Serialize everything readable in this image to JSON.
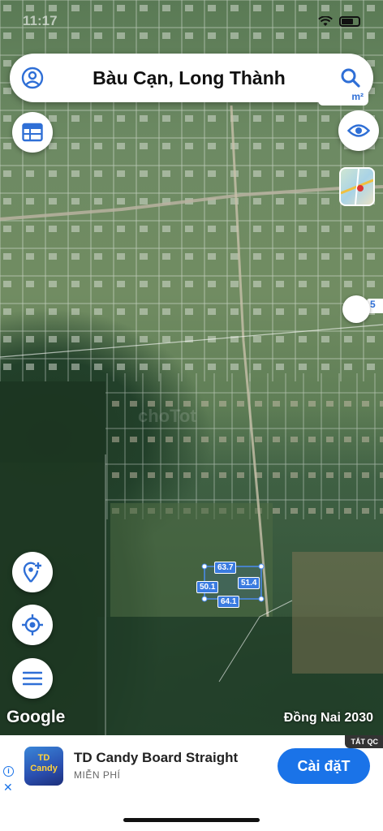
{
  "status": {
    "time": "11:17"
  },
  "search": {
    "title": "Bàu Cạn, Long Thành"
  },
  "map": {
    "scale_hint": "m²",
    "side_hint": "5",
    "measurements": [
      "63.7",
      "51.4",
      "50.1",
      "64.1"
    ],
    "watermark": "choTot",
    "attribution": "Google",
    "plan_label": "Đồng Nai 2030"
  },
  "icons": {
    "profile": "profile-icon",
    "search": "search-icon",
    "layers": "calendar-icon",
    "eye": "eye-icon",
    "add_location": "add-location-icon",
    "my_location": "my-location-icon",
    "menu": "menu-icon"
  },
  "ad": {
    "tag": "TẮT QC",
    "app_icon_text": "TD Candy",
    "app_name": "TD Candy Board Straight",
    "price": "MIỄN PHÍ",
    "cta": "Cài đặT"
  },
  "colors": {
    "accent": "#2f6fd6",
    "cta": "#1a73e8",
    "plot": "#3a7be0"
  }
}
